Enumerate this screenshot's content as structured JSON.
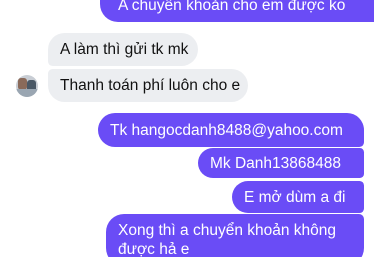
{
  "conversation": {
    "messages": [
      {
        "side": "outgoing",
        "text": "A chuyển khoản cho em được ko"
      },
      {
        "side": "incoming",
        "text": "A làm thì gửi tk mk"
      },
      {
        "side": "incoming",
        "text": "Thanh toán phí luôn cho e"
      },
      {
        "side": "outgoing",
        "text": "Tk hangocdanh8488@yahoo.com"
      },
      {
        "side": "outgoing",
        "text": "Mk Danh13868488"
      },
      {
        "side": "outgoing",
        "text": "E mở dùm a đi"
      },
      {
        "side": "outgoing",
        "text_line1": "Xong thì a chuyển khoản không",
        "text_line2": "được hả e"
      }
    ]
  },
  "colors": {
    "outgoing_bubble": "#6a4cf6",
    "incoming_bubble": "#eceef1",
    "outgoing_text": "#ffffff",
    "incoming_text": "#111111"
  },
  "icons": {
    "sender_avatar": "avatar"
  }
}
